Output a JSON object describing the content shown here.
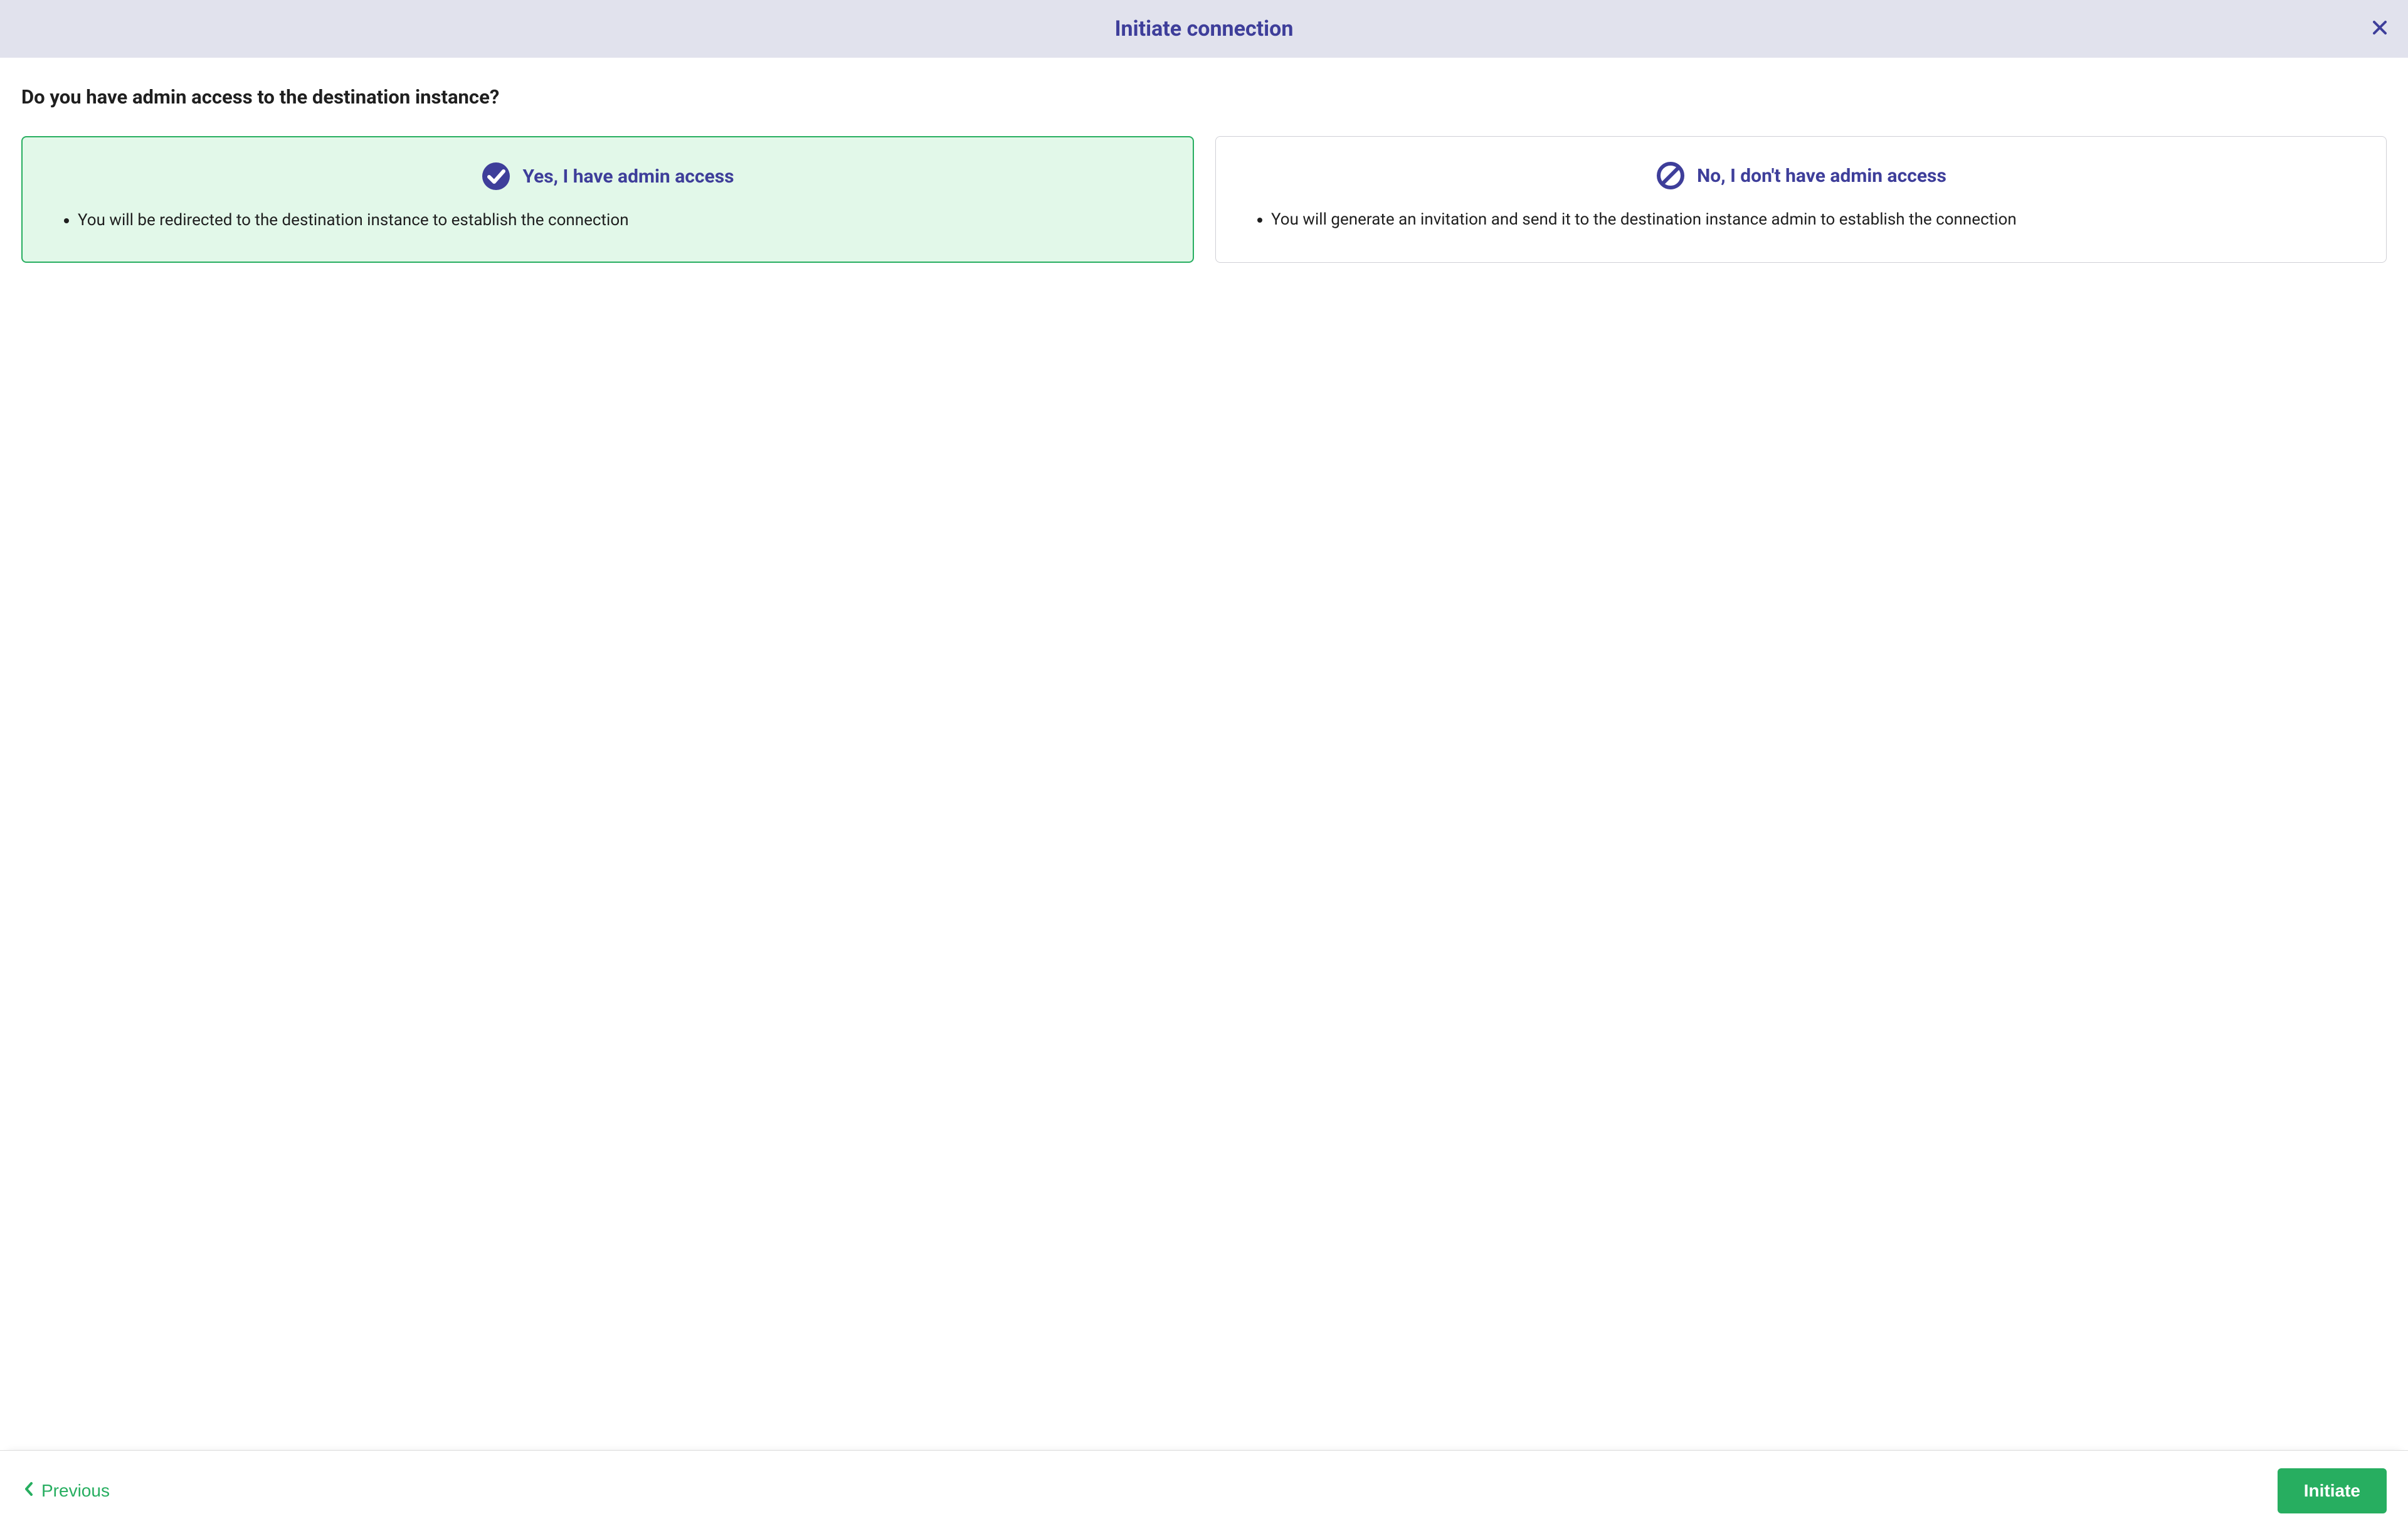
{
  "header": {
    "title": "Initiate connection"
  },
  "question": "Do you have admin access to the destination instance?",
  "options": {
    "yes": {
      "title": "Yes, I have admin access",
      "bullet": "You will be redirected to the destination instance to establish the connection",
      "selected": true
    },
    "no": {
      "title": "No, I don't have admin access",
      "bullet": "You will generate an invitation and send it to the destination instance admin to establish the connection",
      "selected": false
    }
  },
  "footer": {
    "previous": "Previous",
    "initiate": "Initiate"
  },
  "colors": {
    "brand": "#3e3e9a",
    "success": "#27ae60",
    "header_bg": "#e1e2ed",
    "selected_bg": "#e2f8e9"
  }
}
